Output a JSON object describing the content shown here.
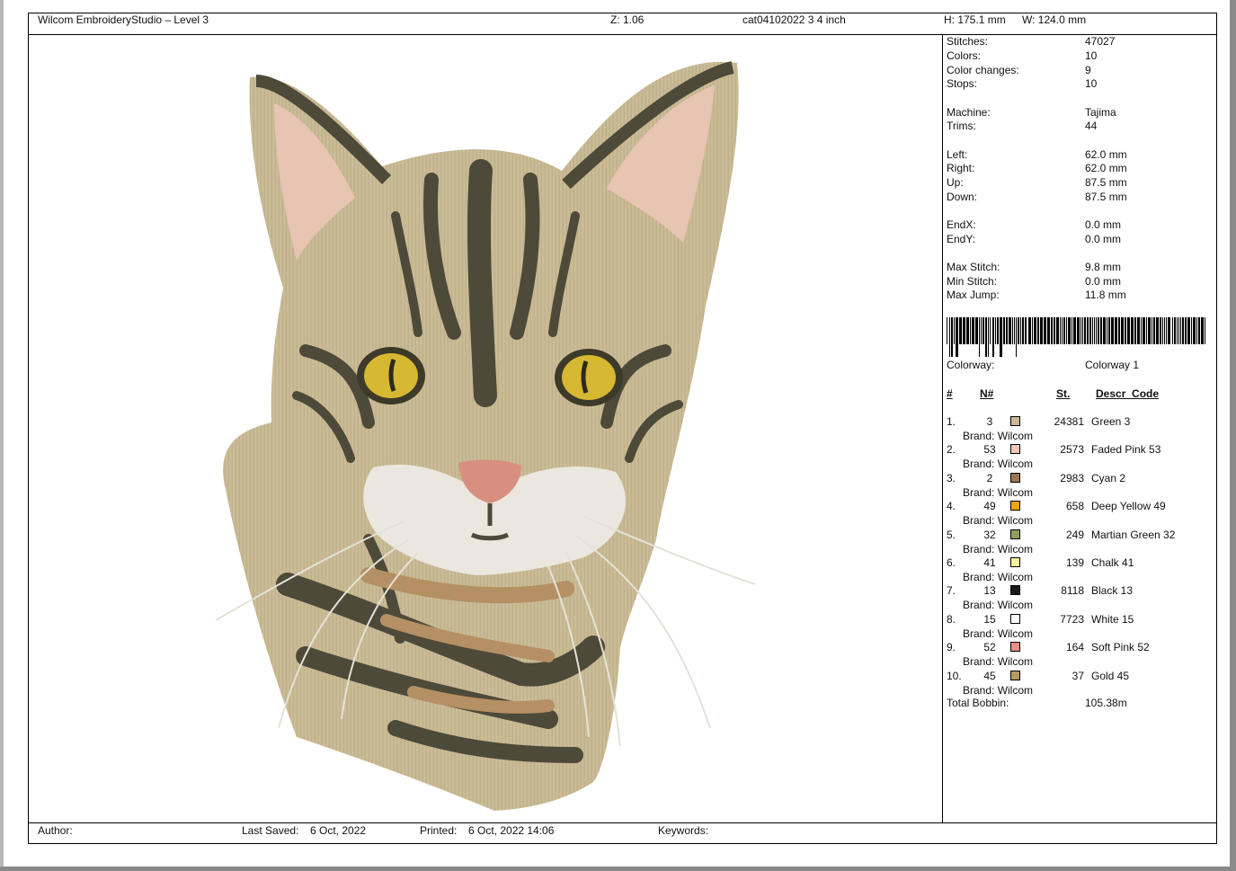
{
  "header": {
    "app_title": "Wilcom EmbroideryStudio – Level 3",
    "zoom": "Z: 1.06",
    "design_name": "cat04102022 3 4  inch",
    "height": "H: 175.1 mm",
    "width": "W: 124.0 mm"
  },
  "stats": [
    {
      "label": "Stitches:",
      "value": "47027"
    },
    {
      "label": "Colors:",
      "value": "10"
    },
    {
      "label": "Color changes:",
      "value": "9"
    },
    {
      "label": "Stops:",
      "value": "10"
    },
    {
      "label": "Machine:",
      "value": "Tajima"
    },
    {
      "label": "Trims:",
      "value": "44"
    },
    {
      "label": "Left:",
      "value": "62.0 mm"
    },
    {
      "label": "Right:",
      "value": "62.0 mm"
    },
    {
      "label": "Up:",
      "value": "87.5 mm"
    },
    {
      "label": "Down:",
      "value": "87.5 mm"
    },
    {
      "label": "EndX:",
      "value": "0.0 mm"
    },
    {
      "label": "EndY:",
      "value": "0.0 mm"
    },
    {
      "label": "Max Stitch:",
      "value": "9.8 mm"
    },
    {
      "label": "Min Stitch:",
      "value": "0.0 mm"
    },
    {
      "label": "Max Jump:",
      "value": "11.8 mm"
    }
  ],
  "colorway": {
    "label": "Colorway:",
    "value": "Colorway 1"
  },
  "table_headers": {
    "index": "#",
    "number": "N#",
    "stitches": "St.",
    "descr": "Descr_Code"
  },
  "colors": [
    {
      "index": "1.",
      "number": "3",
      "swatch": "#c9b99a",
      "stitches": "24381",
      "name": "Green 3",
      "brand": "Brand: Wilcom"
    },
    {
      "index": "2.",
      "number": "53",
      "swatch": "#f1c6bd",
      "stitches": "2573",
      "name": "Faded Pink 53",
      "brand": "Brand: Wilcom"
    },
    {
      "index": "3.",
      "number": "2",
      "swatch": "#9a7652",
      "stitches": "2983",
      "name": "Cyan 2",
      "brand": "Brand: Wilcom"
    },
    {
      "index": "4.",
      "number": "49",
      "swatch": "#f0a411",
      "stitches": "658",
      "name": "Deep Yellow 49",
      "brand": "Brand: Wilcom"
    },
    {
      "index": "5.",
      "number": "32",
      "swatch": "#8f9d62",
      "stitches": "249",
      "name": "Martian Green 32",
      "brand": "Brand: Wilcom"
    },
    {
      "index": "6.",
      "number": "41",
      "swatch": "#f7f2a0",
      "stitches": "139",
      "name": "Chalk 41",
      "brand": "Brand: Wilcom"
    },
    {
      "index": "7.",
      "number": "13",
      "swatch": "#1a1a1a",
      "stitches": "8118",
      "name": "Black 13",
      "brand": "Brand: Wilcom"
    },
    {
      "index": "8.",
      "number": "15",
      "swatch": "#ffffff",
      "stitches": "7723",
      "name": "White 15",
      "brand": "Brand: Wilcom"
    },
    {
      "index": "9.",
      "number": "52",
      "swatch": "#e98e86",
      "stitches": "164",
      "name": "Soft Pink 52",
      "brand": "Brand: Wilcom"
    },
    {
      "index": "10.",
      "number": "45",
      "swatch": "#b29a62",
      "stitches": "37",
      "name": "Gold 45",
      "brand": "Brand: Wilcom"
    }
  ],
  "bobbin": {
    "label": "Total Bobbin:",
    "value": "105.38m"
  },
  "footer": {
    "author": "Author:",
    "last_saved_label": "Last Saved:",
    "last_saved": "6 Oct, 2022",
    "printed_label": "Printed:",
    "printed": "6 Oct, 2022 14:06",
    "keywords": "Keywords:"
  },
  "artwork": {
    "colors": {
      "fabric": "#c6b791",
      "stripe": "#4e4a3a",
      "tan": "#b49064",
      "ear": "#e8c4b2",
      "white": "#e9e7de",
      "nose": "#d88f80",
      "eye": "#d6b832",
      "eye_ring": "#3e3a2a",
      "pupil": "#2c2a1c"
    }
  }
}
